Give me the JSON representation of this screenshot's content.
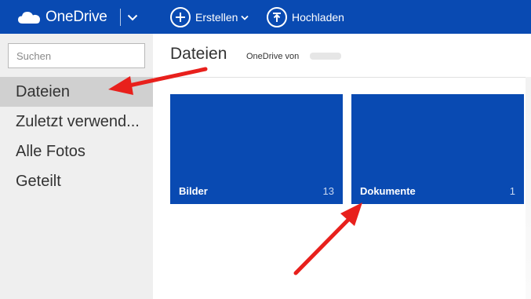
{
  "app": {
    "name": "OneDrive",
    "brand_color": "#094ab2"
  },
  "toolbar": {
    "create_label": "Erstellen",
    "upload_label": "Hochladen",
    "icons": [
      "onedrive-cloud-icon",
      "chevron-down-icon",
      "plus-circle-icon",
      "upload-circle-icon"
    ]
  },
  "sidebar": {
    "search_placeholder": "Suchen",
    "items": [
      {
        "label": "Dateien",
        "active": true
      },
      {
        "label": "Zuletzt verwend..."
      },
      {
        "label": "Alle Fotos"
      },
      {
        "label": "Geteilt"
      }
    ]
  },
  "main": {
    "title": "Dateien",
    "subtitle": "OneDrive von"
  },
  "folders": [
    {
      "name": "Bilder",
      "count": "13"
    },
    {
      "name": "Dokumente",
      "count": "1"
    }
  ],
  "annotations": {
    "arrow_color": "#e8201c"
  }
}
